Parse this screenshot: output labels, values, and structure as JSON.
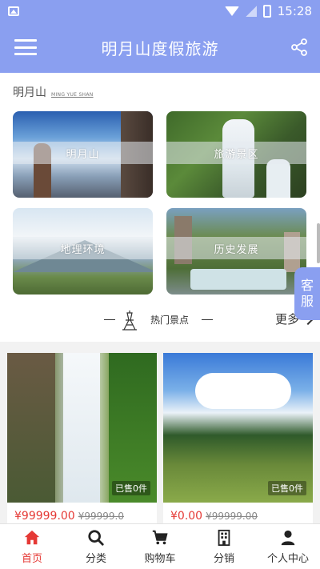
{
  "status_bar": {
    "time": "15:28"
  },
  "header": {
    "title": "明月山度假旅游"
  },
  "brand": {
    "name_cn": "明月山",
    "name_en": "MING YUE SHAN"
  },
  "categories": [
    {
      "label": "明月山"
    },
    {
      "label": "旅游景区"
    },
    {
      "label": "地理环境"
    },
    {
      "label": "历史发展"
    }
  ],
  "hot": {
    "label": "热门景点",
    "more": "更多"
  },
  "service": {
    "line1": "客",
    "line2": "服"
  },
  "products": [
    {
      "sold": "已售0件",
      "price": "¥99999.00",
      "old_price": "¥99999.0"
    },
    {
      "sold": "已售0件",
      "price": "¥0.00",
      "old_price": "¥99999.00"
    }
  ],
  "nav": [
    {
      "label": "首页",
      "icon": "home-icon",
      "active": true
    },
    {
      "label": "分类",
      "icon": "search-icon",
      "active": false
    },
    {
      "label": "购物车",
      "icon": "cart-icon",
      "active": false
    },
    {
      "label": "分销",
      "icon": "building-icon",
      "active": false
    },
    {
      "label": "个人中心",
      "icon": "user-icon",
      "active": false
    }
  ],
  "colors": {
    "primary": "#8a9ff0",
    "price": "#e53935",
    "active_nav": "#e53935"
  }
}
